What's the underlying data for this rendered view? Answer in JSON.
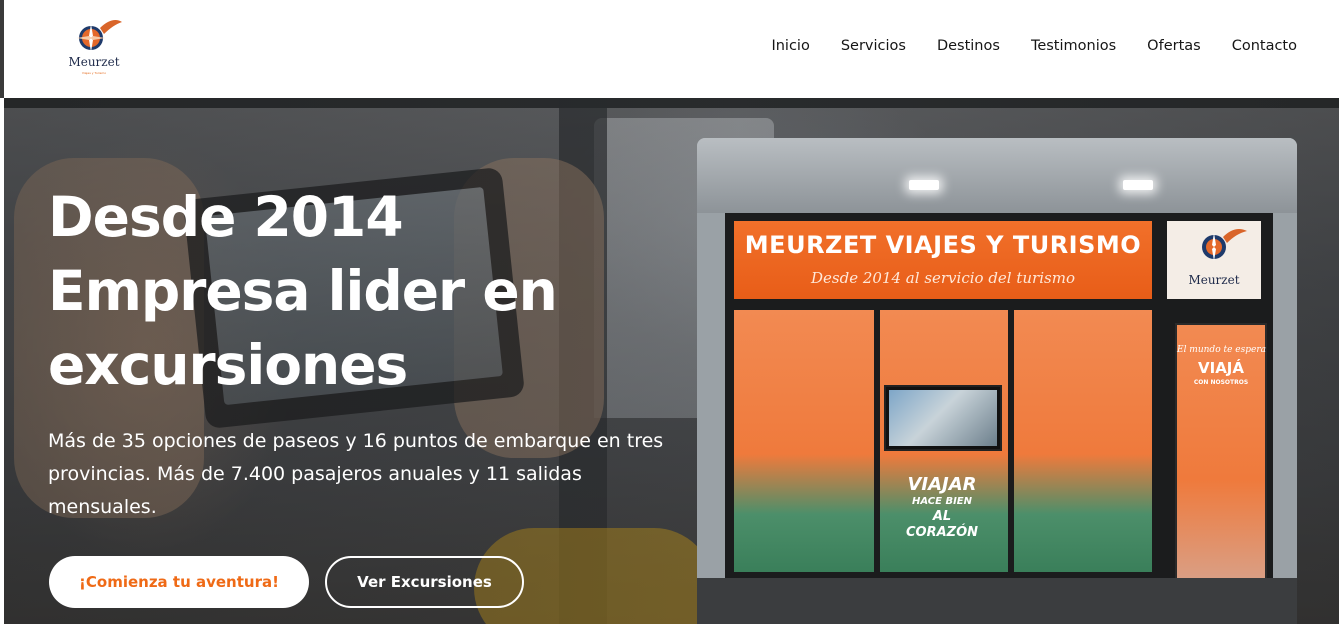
{
  "brand": {
    "name": "Meurzet",
    "tagline": "Viajes y Turismo",
    "colors": {
      "accent": "#ef6a16",
      "navy": "#1e2a4a"
    }
  },
  "nav": {
    "items": [
      {
        "label": "Inicio"
      },
      {
        "label": "Servicios"
      },
      {
        "label": "Destinos"
      },
      {
        "label": "Testimonios"
      },
      {
        "label": "Ofertas"
      },
      {
        "label": "Contacto"
      }
    ]
  },
  "hero": {
    "headline_lines": [
      "Desde 2014",
      "Empresa lider en",
      "excursiones"
    ],
    "lead": "Más de 35 opciones de paseos y 16 puntos de embarque en tres provincias. Más de 7.400 pasajeros anuales y 11 salidas mensuales.",
    "primary_button": "¡Comienza tu aventura!",
    "secondary_button": "Ver Excursiones"
  },
  "store_photo": {
    "sign_title": "MEURZET VIAJES Y TURISMO",
    "sign_subtitle": "Desde 2014 al servicio del turismo",
    "side_sign": "Meurzet",
    "door_script": "El mundo te espera",
    "door_title": "VIAJÁ",
    "door_subtitle": "CON NOSOTROS",
    "slogan": [
      "VIAJAR",
      "HACE BIEN",
      "AL CORAZÓN"
    ]
  }
}
